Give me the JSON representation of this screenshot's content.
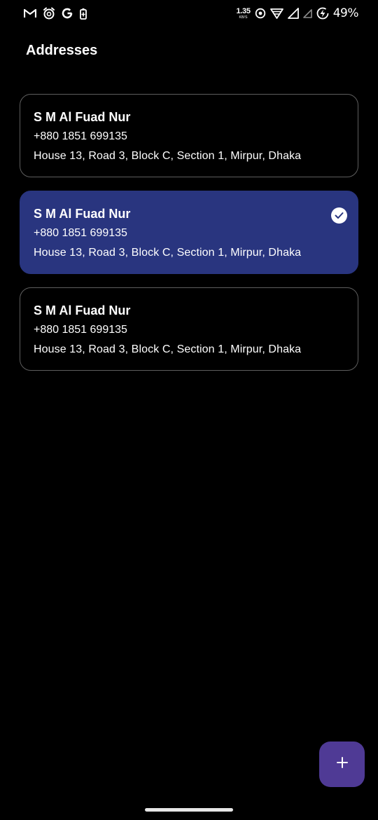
{
  "status_bar": {
    "left_icons": [
      "gmail-icon",
      "alarm-app-icon",
      "google-icon",
      "battery-saver-icon"
    ],
    "net_speed_value": "1.35",
    "net_speed_unit": "KB/S",
    "right_icons": [
      "data-saver-icon",
      "wifi-icon",
      "signal-icon",
      "signal-2-icon",
      "charging-icon"
    ],
    "battery_percent": "49%"
  },
  "page": {
    "title": "Addresses"
  },
  "addresses": [
    {
      "name": "S M Al Fuad Nur",
      "phone": "+880 1851 699135",
      "address": "House 13, Road 3, Block C, Section 1, Mirpur, Dhaka",
      "selected": false
    },
    {
      "name": "S M Al Fuad Nur",
      "phone": "+880 1851 699135",
      "address": "House 13, Road 3, Block C, Section 1, Mirpur, Dhaka",
      "selected": true
    },
    {
      "name": "S M Al Fuad Nur",
      "phone": "+880 1851 699135",
      "address": "House 13, Road 3, Block C, Section 1, Mirpur, Dhaka",
      "selected": false
    }
  ],
  "fab": {
    "icon": "plus-icon"
  },
  "colors": {
    "background": "#000000",
    "card_border": "#5e5e5e",
    "selected_card": "#29357f",
    "fab": "#4f3a95",
    "text": "#ffffff"
  }
}
